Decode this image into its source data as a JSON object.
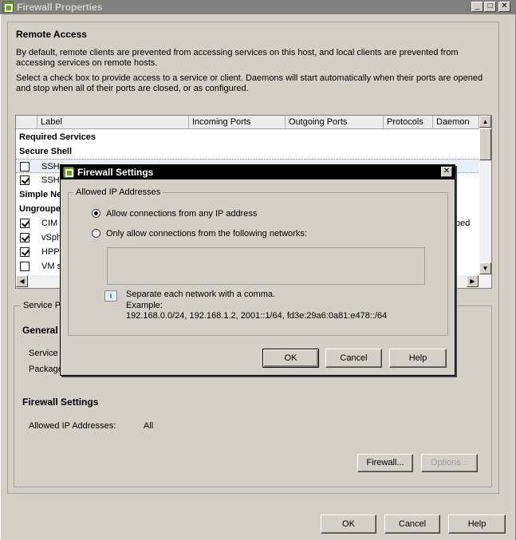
{
  "window": {
    "title": "Firewall Properties",
    "controls": {
      "minimize": "_",
      "maximize": "□",
      "close": "✕"
    }
  },
  "remote_access": {
    "heading": "Remote Access",
    "description1": "By default, remote clients are prevented from accessing services on this host, and local clients are prevented from accessing services on remote hosts.",
    "description2": "Select a check box to provide access to a service or client. Daemons will start automatically when their ports are opened and stop when all of their ports are closed, or as configured."
  },
  "list": {
    "columns": [
      "Label",
      "Incoming Ports",
      "Outgoing Ports",
      "Protocols",
      "Daemon"
    ],
    "rows": [
      {
        "type": "group",
        "label": "Required Services"
      },
      {
        "type": "group",
        "label": "Secure Shell"
      },
      {
        "type": "item",
        "label": "SSH",
        "checked": false,
        "extra": "",
        "selected": true
      },
      {
        "type": "item",
        "label": "SSH",
        "checked": true,
        "extra": ""
      },
      {
        "type": "group",
        "label": "Simple Ne"
      },
      {
        "type": "group",
        "label": "Ungroupe"
      },
      {
        "type": "item",
        "label": "CIM",
        "checked": true,
        "extra": "ped"
      },
      {
        "type": "item",
        "label": "vSph",
        "checked": true,
        "extra": ""
      },
      {
        "type": "item",
        "label": "HPPr",
        "checked": true,
        "extra": ""
      },
      {
        "type": "item",
        "label": "VM s",
        "checked": false,
        "extra": ""
      }
    ]
  },
  "service_properties": {
    "group_label": "Service P",
    "general_heading": "General",
    "service_label": "Service",
    "package_label": "Package",
    "fw_heading": "Firewall Settings",
    "allowed_label": "Allowed IP Addresses:",
    "allowed_value": "All",
    "firewall_button": "Firewall...",
    "options_button": "Options..."
  },
  "footer": {
    "ok": "OK",
    "cancel": "Cancel",
    "help": "Help"
  },
  "dialog": {
    "title": "Firewall Settings",
    "group_label": "Allowed IP Addresses",
    "option_any": "Allow connections from any IP address",
    "option_networks": "Only allow connections from the following networks:",
    "networks_value": "",
    "hint": "Separate each network with a comma.",
    "example_label": "Example:",
    "example_value": "192.168.0.0/24, 192.168.1.2, 2001::1/64, fd3e:29a6:0a81:e478::/64",
    "selected_option": "any",
    "ok": "OK",
    "cancel": "Cancel",
    "help": "Help"
  }
}
